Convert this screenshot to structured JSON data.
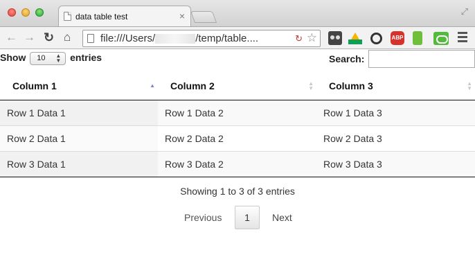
{
  "browser": {
    "tab_title": "data table test",
    "tab_close": "×",
    "url_prefix": "file:///Users/",
    "url_suffix": "/temp/table....",
    "icons": {
      "back": "←",
      "forward": "→",
      "reload": "C",
      "home": "⌂",
      "star": "☆",
      "ext_in_url": "↻",
      "resize": "⤢"
    },
    "extension_abp_label": "ABP"
  },
  "table_controls": {
    "length_prefix": "Show",
    "length_value": "10",
    "length_suffix": "entries",
    "search_label": "Search:",
    "search_value": ""
  },
  "table": {
    "columns": [
      "Column 1",
      "Column 2",
      "Column 3"
    ],
    "sorted_column": "Column 1",
    "sort_direction": "ascending",
    "rows": [
      [
        "Row 1 Data 1",
        "Row 1 Data 2",
        "Row 1 Data 3"
      ],
      [
        "Row 2 Data 1",
        "Row 2 Data 2",
        "Row 2 Data 3"
      ],
      [
        "Row 3 Data 1",
        "Row 3 Data 2",
        "Row 3 Data 3"
      ]
    ]
  },
  "footer": {
    "info": "Showing 1 to 3 of 3 entries",
    "previous": "Previous",
    "current_page": "1",
    "next": "Next"
  }
}
